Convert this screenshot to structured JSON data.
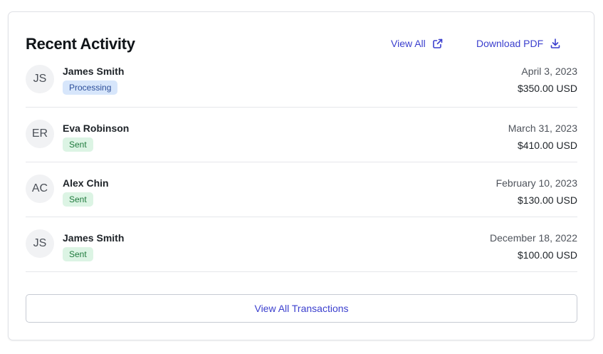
{
  "card": {
    "title": "Recent Activity",
    "view_all_label": "View All",
    "view_all_icon": "external-link-icon",
    "download_label": "Download PDF",
    "download_icon": "download-icon",
    "footer_button_label": "View All Transactions"
  },
  "transactions": [
    {
      "initials": "JS",
      "name": "James Smith",
      "status": "Processing",
      "date": "April 3, 2023",
      "amount": "$350.00 USD"
    },
    {
      "initials": "ER",
      "name": "Eva Robinson",
      "status": "Sent",
      "date": "March 31, 2023",
      "amount": "$410.00 USD"
    },
    {
      "initials": "AC",
      "name": "Alex Chin",
      "status": "Sent",
      "date": "February 10, 2023",
      "amount": "$130.00 USD"
    },
    {
      "initials": "JS",
      "name": "James Smith",
      "status": "Sent",
      "date": "December 18, 2022",
      "amount": "$100.00 USD"
    }
  ],
  "colors": {
    "accent": "#3b3fce",
    "processing_badge_bg": "#d7e6fb",
    "processing_badge_text": "#2c4f9a",
    "sent_badge_bg": "#dcf4e4",
    "sent_badge_text": "#1f7a3d"
  }
}
